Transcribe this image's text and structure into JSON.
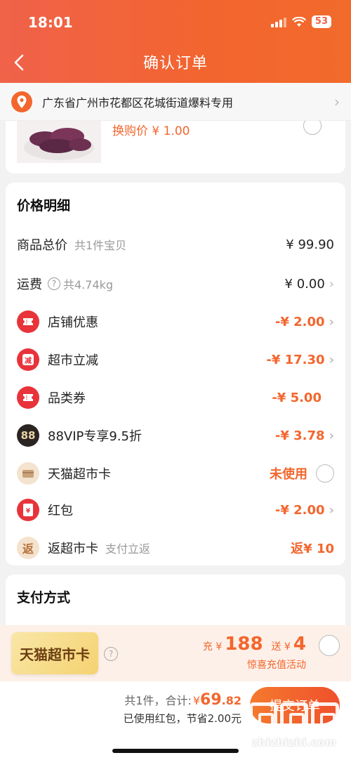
{
  "status_bar": {
    "time": "18:01",
    "battery": "53"
  },
  "header": {
    "title": "确认订单"
  },
  "address": {
    "text": "广东省广州市花都区花城街道爆料专用"
  },
  "product": {
    "exchange_price": "换购价 ¥ 1.00"
  },
  "price_detail": {
    "title": "价格明细",
    "rows": [
      {
        "label": "商品总价",
        "sub": "共1件宝贝",
        "value": "¥ 99.90"
      },
      {
        "label": "运费",
        "sub": "共4.74kg",
        "value": "¥ 0.00"
      },
      {
        "label": "店铺优惠",
        "value": "-¥ 2.00"
      },
      {
        "label": "超市立减",
        "icon_text": "减",
        "value": "-¥ 17.30"
      },
      {
        "label": "品类券",
        "value": "-¥ 5.00"
      },
      {
        "label": "88VIP专享9.5折",
        "icon_text": "88",
        "value": "-¥ 3.78"
      },
      {
        "label": "天猫超市卡",
        "value": "未使用"
      },
      {
        "label": "红包",
        "icon_text": "¥",
        "value": "-¥ 2.00"
      },
      {
        "label": "返超市卡",
        "sub": "支付立返",
        "icon_text": "返",
        "value": "返¥ 10"
      }
    ]
  },
  "payment": {
    "title": "支付方式"
  },
  "promo": {
    "card_label": "天猫超市卡",
    "charge_prefix": "充 ¥",
    "charge_amount": "188",
    "gift_prefix": "送 ¥",
    "gift_amount": "4",
    "subtitle": "惊喜充值活动"
  },
  "footer": {
    "count_text": "共1件，合计:",
    "currency": "¥",
    "total_int": "69",
    "total_dec": ".82",
    "saved_text": "已使用红包，节省2.00元",
    "submit_label": "提交订单"
  },
  "watermark": {
    "text": "zhizhizhi.com"
  },
  "colors": {
    "accent": "#f3662e",
    "header": "#f0624a",
    "coupon_red": "#e8333a"
  }
}
